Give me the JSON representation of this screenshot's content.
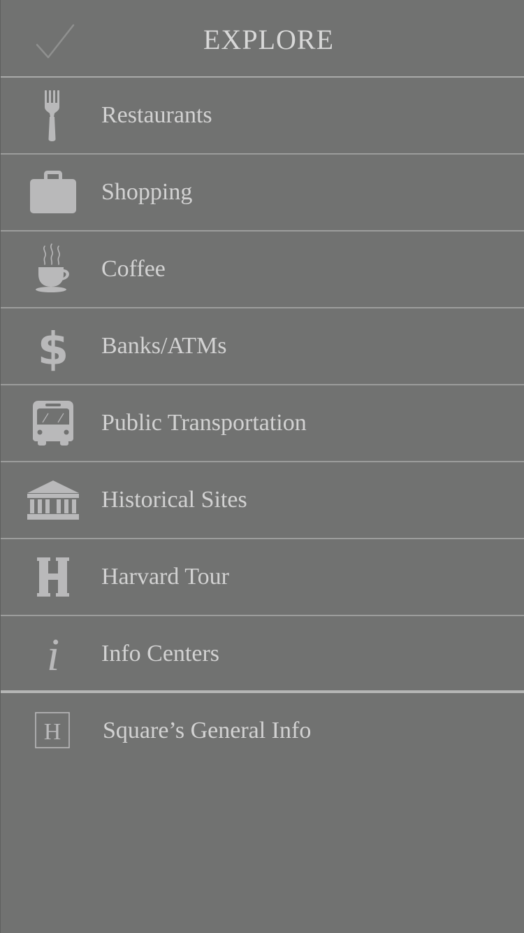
{
  "header": {
    "title": "EXPLORE",
    "check_icon": "checkmark-icon"
  },
  "menu": {
    "items": [
      {
        "label": "Restaurants",
        "icon": "fork-icon"
      },
      {
        "label": "Shopping",
        "icon": "briefcase-icon"
      },
      {
        "label": "Coffee",
        "icon": "coffee-cup-icon"
      },
      {
        "label": "Banks/ATMs",
        "icon": "dollar-icon"
      },
      {
        "label": "Public Transportation",
        "icon": "bus-icon"
      },
      {
        "label": "Historical Sites",
        "icon": "building-columns-icon"
      },
      {
        "label": "Harvard Tour",
        "icon": "harvard-h-icon"
      },
      {
        "label": "Info Centers",
        "icon": "info-icon"
      }
    ],
    "general": {
      "label": "Square’s General Info",
      "icon": "h-box-icon",
      "icon_letter": "H"
    }
  },
  "colors": {
    "background": "#717271",
    "icon": "#b9b9ba",
    "text": "#d2d2d2",
    "divider": "#9c9d9c"
  }
}
